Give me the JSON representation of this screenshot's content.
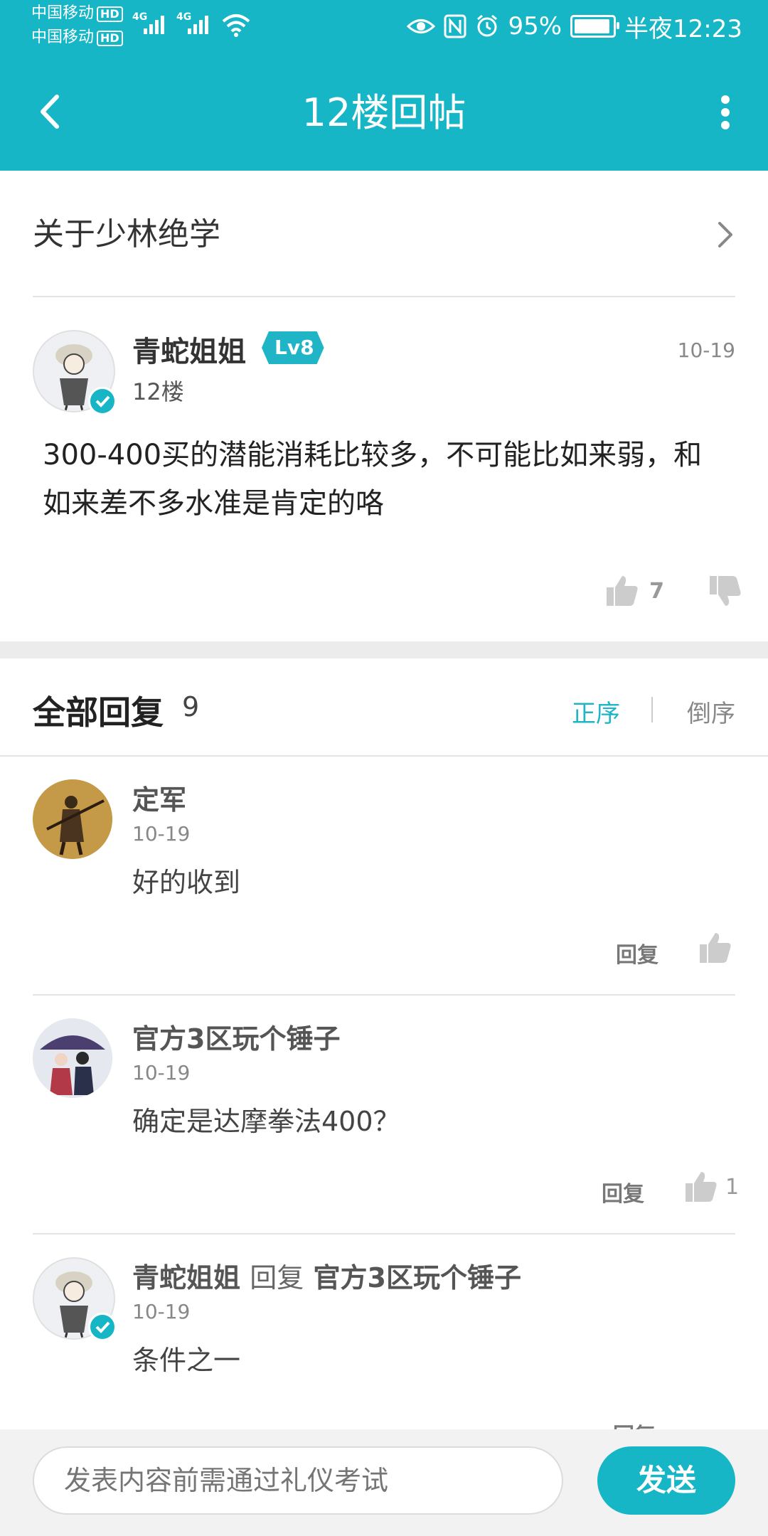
{
  "status_bar": {
    "carrier1": "中国移动",
    "carrier2": "中国移动",
    "hd": "HD",
    "network1": "4G",
    "network2": "4G",
    "battery_percent": "95%",
    "battery_level": 0.95,
    "time": "半夜12:23"
  },
  "nav": {
    "title": "12楼回帖"
  },
  "topic": {
    "title": "关于少林绝学"
  },
  "main_post": {
    "author": "青蛇姐姐",
    "level": "Lv8",
    "floor": "12楼",
    "date": "10-19",
    "content": "300-400买的潜能消耗比较多，不可能比如来弱，和如来差不多水准是肯定的咯",
    "likes": "7"
  },
  "replies_header": {
    "title": "全部回复",
    "count": "9",
    "sort_asc": "正序",
    "sort_desc": "倒序"
  },
  "replies": [
    {
      "author": "定军",
      "date": "10-19",
      "text": "好的收到",
      "reply_label": "回复",
      "likes": ""
    },
    {
      "author": "官方3区玩个锤子",
      "date": "10-19",
      "text": "确定是达摩拳法400？",
      "reply_label": "回复",
      "likes": "1"
    },
    {
      "author": "青蛇姐姐",
      "reply_word": "回复",
      "reply_to": "官方3区玩个锤子",
      "date": "10-19",
      "text": "条件之一",
      "reply_label": "回复"
    }
  ],
  "composer": {
    "placeholder": "发表内容前需通过礼仪考试",
    "send_label": "发送"
  },
  "colors": {
    "accent": "#17b6c7"
  }
}
